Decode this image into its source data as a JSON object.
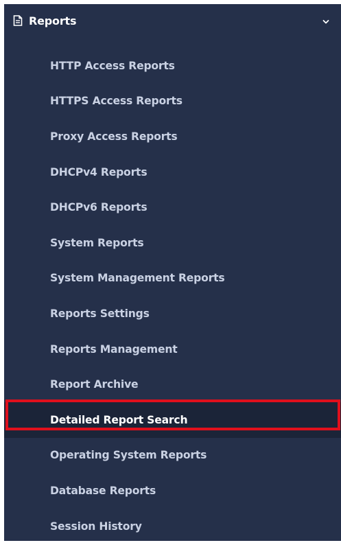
{
  "section": {
    "title": "Reports",
    "icon": "document-icon",
    "expand_icon": "chevron-down-icon"
  },
  "menu": {
    "items": [
      {
        "label": "HTTP Access Reports"
      },
      {
        "label": "HTTPS Access Reports"
      },
      {
        "label": "Proxy Access Reports"
      },
      {
        "label": "DHCPv4 Reports"
      },
      {
        "label": "DHCPv6 Reports"
      },
      {
        "label": "System Reports"
      },
      {
        "label": "System Management Reports"
      },
      {
        "label": "Reports Settings"
      },
      {
        "label": "Reports Management"
      },
      {
        "label": "Report Archive"
      },
      {
        "label": "Detailed Report Search"
      },
      {
        "label": "Operating System Reports"
      },
      {
        "label": "Database Reports"
      },
      {
        "label": "Session History"
      }
    ],
    "active_index": 10
  },
  "colors": {
    "sidebar_bg": "#25304a",
    "active_bg": "#1b2438",
    "item_text": "#c9d1e3",
    "active_text": "#ffffff",
    "highlight_border": "#e0101c"
  }
}
